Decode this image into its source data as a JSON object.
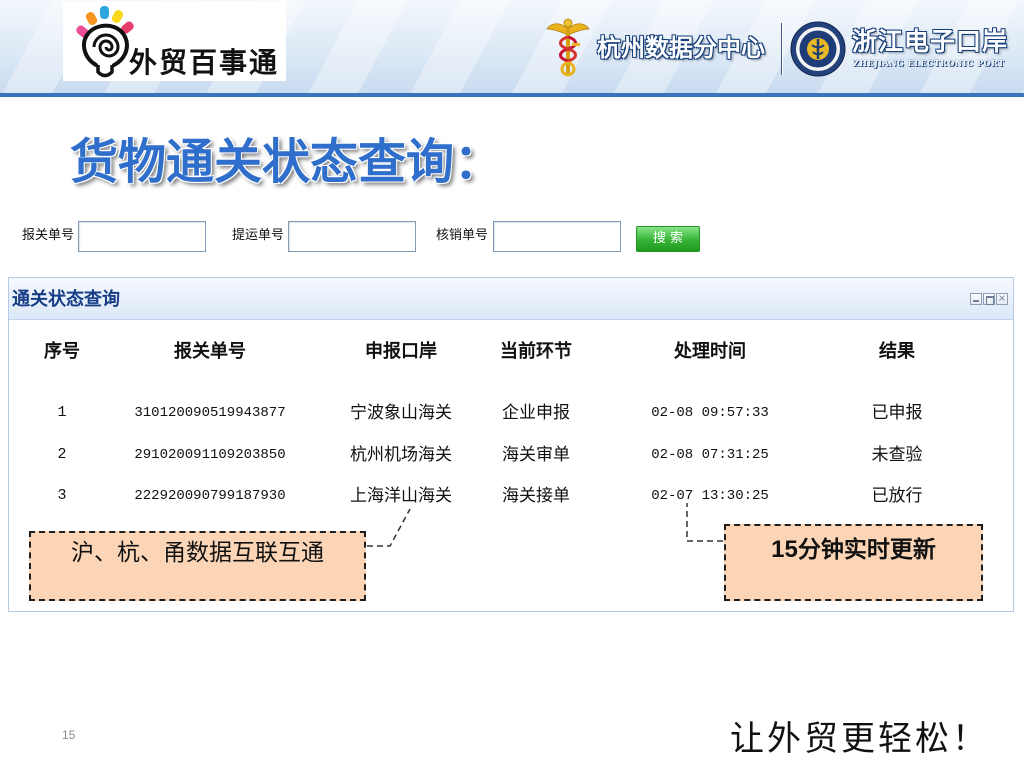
{
  "header": {
    "logo_text": "外贸百事通",
    "center_name": "杭州数据分中心",
    "port_name": "浙江电子口岸",
    "port_name_en": "ZHEJIANG ELECTRONIC PORT"
  },
  "title": "货物通关状态查询：",
  "search": {
    "fields": [
      {
        "label": "报关单号",
        "value": ""
      },
      {
        "label": "提运单号",
        "value": ""
      },
      {
        "label": "核销单号",
        "value": ""
      }
    ],
    "button_label": "搜 索"
  },
  "panel": {
    "title": "通关状态查询",
    "columns": [
      "序号",
      "报关单号",
      "申报口岸",
      "当前环节",
      "处理时间",
      "结果"
    ],
    "rows": [
      [
        "1",
        "310120090519943877",
        "宁波象山海关",
        "企业申报",
        "02-08 09:57:33",
        "已申报"
      ],
      [
        "2",
        "291020091109203850",
        "杭州机场海关",
        "海关审单",
        "02-08 07:31:25",
        "未查验"
      ],
      [
        "3",
        "222920090799187930",
        "上海洋山海关",
        "海关接单",
        "02-07 13:30:25",
        "已放行"
      ]
    ]
  },
  "callouts": {
    "interconnect": "沪、杭、甬数据互联互通",
    "update_number": "15",
    "update_text": "分钟实时更新"
  },
  "footer": {
    "page_number": "15",
    "slogan": "让外贸更轻松！"
  },
  "icons": {
    "brand": "lightbulb-logo-icon",
    "center": "customs-emblem-icon",
    "port": "port-emblem-icon",
    "window_controls": [
      "minimize-icon",
      "maximize-icon",
      "close-icon"
    ]
  },
  "colors": {
    "title_blue": "#2F6ECA",
    "header_blue": "#3A74BE",
    "panel_title": "#173D87",
    "button_green": "#36B336",
    "callout_fill": "#FBD5B5"
  }
}
